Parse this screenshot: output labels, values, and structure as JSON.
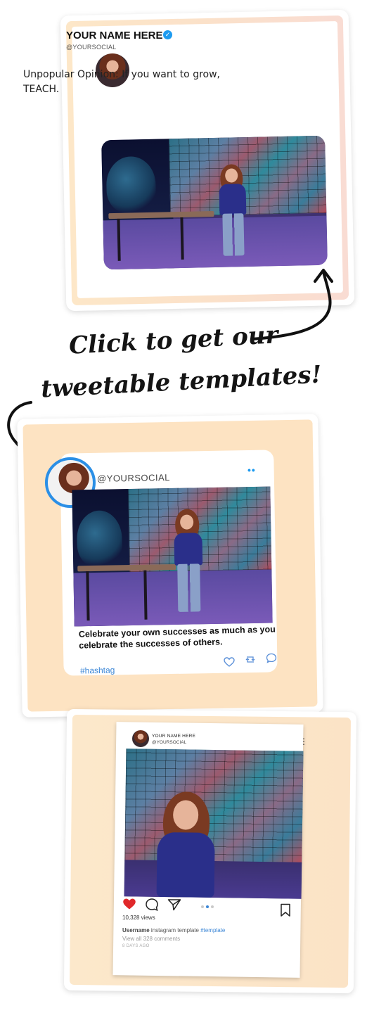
{
  "tweet_card": {
    "name": "YOUR NAME HERE",
    "handle": "@YOURSOCIAL",
    "verified_icon": "verified-check-icon",
    "text": "Unpopular Opinion:  If you want to grow, TEACH."
  },
  "cta": {
    "line1": "Click to get our",
    "line2": "tweetable templates!"
  },
  "post_card": {
    "handle": "@YOURSOCIAL",
    "menu": "••",
    "caption": "Celebrate your own successes as much as you celebrate the successes of others.",
    "hashtag": "#hashtag",
    "icons": [
      "heart-icon",
      "retweet-icon",
      "comment-icon"
    ]
  },
  "instagram_card": {
    "name": "YOUR NAME HERE",
    "handle": "@YOURSOCIAL",
    "menu": "⋮",
    "views": "10,328 views",
    "caption_user": "Username",
    "caption_text": "instagram template",
    "caption_tag": "#template",
    "comments": "View all 328 comments",
    "posted": "8 DAYS AGO",
    "icons": [
      "heart-filled-icon",
      "comment-icon",
      "share-icon",
      "bookmark-icon"
    ]
  },
  "colors": {
    "accent_blue": "#1d9bf0",
    "heart_red": "#e0282a",
    "card_peach": "#fde3c2"
  }
}
